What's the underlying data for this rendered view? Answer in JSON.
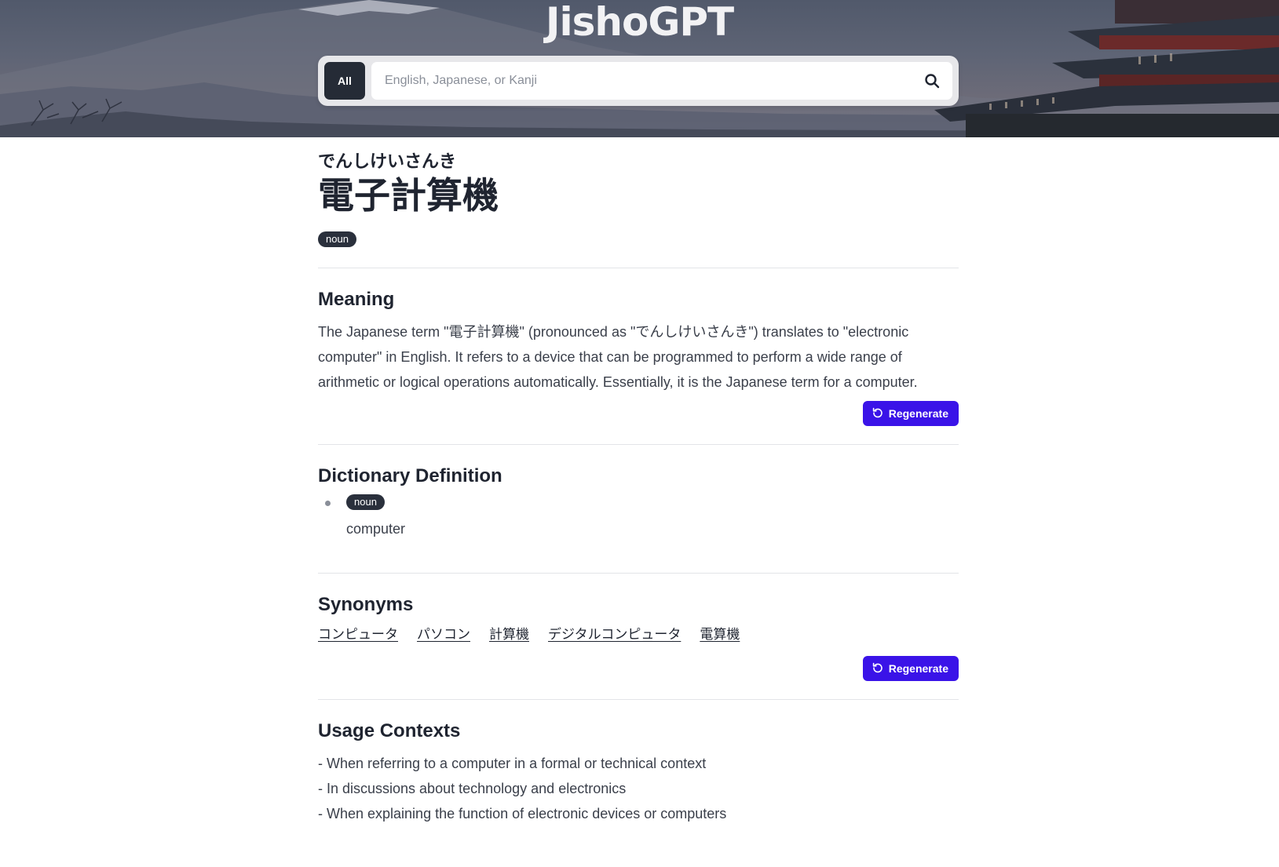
{
  "brand": {
    "title": "JishoGPT"
  },
  "search": {
    "filter_label": "All",
    "placeholder": "English, Japanese, or Kanji",
    "value": ""
  },
  "entry": {
    "reading": "でんしけいさんき",
    "headword": "電子計算機",
    "part_of_speech": "noun"
  },
  "meaning": {
    "title": "Meaning",
    "text": "The Japanese term \"電子計算機\" (pronounced as \"でんしけいさんき\") translates to \"electronic computer\" in English. It refers to a device that can be programmed to perform a wide range of arithmetic or logical operations automatically. Essentially, it is the Japanese term for a computer.",
    "regenerate_label": "Regenerate"
  },
  "dictionary": {
    "title": "Dictionary Definition",
    "items": [
      {
        "pos": "noun",
        "definition": "computer"
      }
    ]
  },
  "synonyms": {
    "title": "Synonyms",
    "items": [
      "コンピュータ",
      "パソコン",
      "計算機",
      "デジタルコンピュータ",
      "電算機"
    ],
    "regenerate_label": "Regenerate"
  },
  "usage": {
    "title": "Usage Contexts",
    "items": [
      "- When referring to a computer in a formal or technical context",
      "- In discussions about technology and electronics",
      "- When explaining the function of electronic devices or computers"
    ]
  },
  "colors": {
    "accent": "#3a13e8",
    "pill_bg": "#2a303c",
    "text": "#1f2430"
  },
  "icons": {
    "search": "search-icon",
    "regenerate": "rotate-ccw-icon"
  }
}
